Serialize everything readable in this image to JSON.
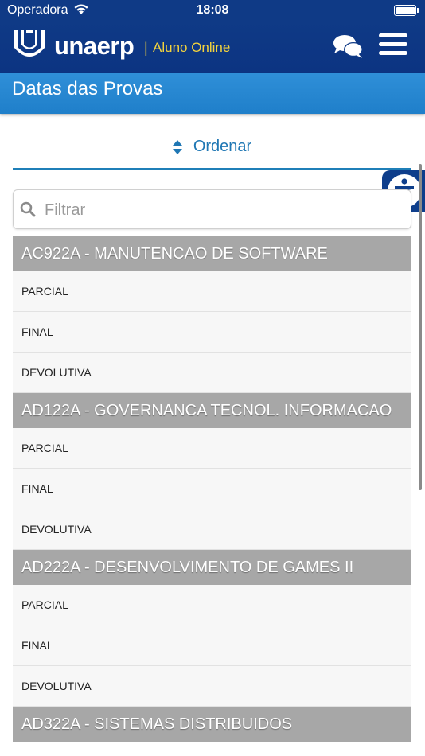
{
  "status_bar": {
    "carrier": "Operadora",
    "time": "18:08"
  },
  "header": {
    "brand": "unaerp",
    "separator": "|",
    "subtitle": "Aluno Online"
  },
  "page": {
    "title": "Datas das Provas"
  },
  "sort": {
    "label": "Ordenar"
  },
  "filter": {
    "placeholder": "Filtrar",
    "value": ""
  },
  "courses": [
    {
      "title": "AC922A - MANUTENCAO DE SOFTWARE",
      "exams": [
        "PARCIAL",
        "FINAL",
        "DEVOLUTIVA"
      ]
    },
    {
      "title": "AD122A - GOVERNANCA TECNOL. INFORMACAO",
      "exams": [
        "PARCIAL",
        "FINAL",
        "DEVOLUTIVA"
      ]
    },
    {
      "title": "AD222A - DESENVOLVIMENTO DE GAMES II",
      "exams": [
        "PARCIAL",
        "FINAL",
        "DEVOLUTIVA"
      ]
    },
    {
      "title": "AD322A - SISTEMAS DISTRIBUIDOS",
      "exams": []
    }
  ],
  "colors": {
    "header_bg": "#0f3a86",
    "title_bar": "#2f8fd8",
    "accent": "#1f77b4",
    "brand_sub": "#f3d33d",
    "course_header": "#a7a7a7"
  },
  "icons": {
    "wifi": "wifi-icon",
    "battery": "battery-icon",
    "logo": "unaerp-logo-icon",
    "chat": "chat-icon",
    "menu": "hamburger-menu-icon",
    "sort": "sort-icon",
    "accessibility": "accessibility-icon",
    "search": "search-icon"
  }
}
